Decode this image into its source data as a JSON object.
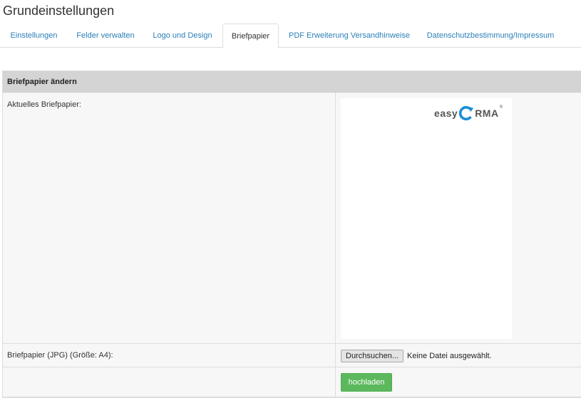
{
  "page": {
    "title": "Grundeinstellungen"
  },
  "tabs": [
    {
      "label": "Einstellungen",
      "active": false
    },
    {
      "label": "Felder verwalten",
      "active": false
    },
    {
      "label": "Logo und Design",
      "active": false
    },
    {
      "label": "Briefpapier",
      "active": true
    },
    {
      "label": "PDF Erweiterung Versandhinweise",
      "active": false
    },
    {
      "label": "Datenschutzbestimmung/Impressum",
      "active": false
    }
  ],
  "panel": {
    "header": "Briefpapier ändern",
    "current_label": "Aktuelles Briefpapier:",
    "letterhead_logo": {
      "text_left": "easy",
      "text_right": "RMA",
      "reg": "®",
      "icon": "refresh-c-icon",
      "accent": "#1a8fd6"
    },
    "upload_label": "Briefpapier (JPG) (Größe: A4):",
    "file_button": "Durchsuchen...",
    "file_status": "Keine Datei ausgewählt.",
    "upload_button": "hochladen"
  },
  "colors": {
    "link": "#2a7fb8",
    "header_bg": "#d4d4d4",
    "row_bg": "#f7f7f7",
    "upload_button": "#5cb85c"
  }
}
